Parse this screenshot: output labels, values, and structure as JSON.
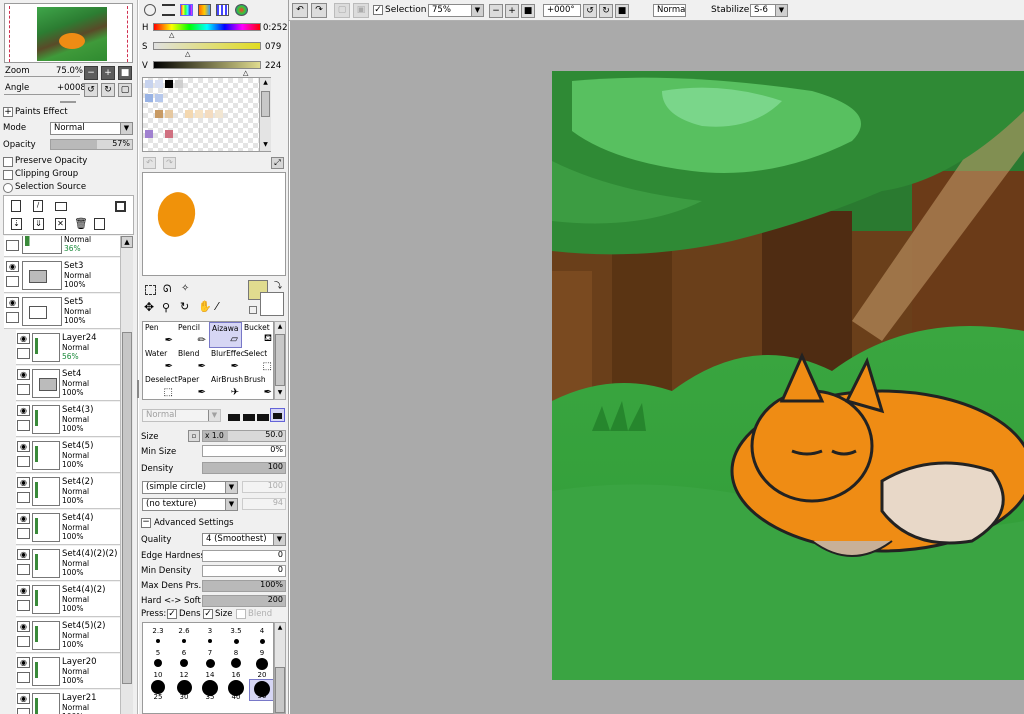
{
  "navigator": {
    "zoom_label": "Zoom",
    "zoom_value": "75.0%",
    "angle_label": "Angle",
    "angle_value": "+0008"
  },
  "paints_effect": {
    "title": "Paints Effect",
    "mode_label": "Mode",
    "mode_value": "Normal",
    "opacity_label": "Opacity",
    "opacity_value": "57%",
    "opacity_level": 0.57,
    "preserve_opacity": "Preserve Opacity",
    "clipping_group": "Clipping Group",
    "selection_source": "Selection Source"
  },
  "layers": [
    {
      "name": "",
      "mode": "Normal",
      "opacity": "36%",
      "kind": "partial",
      "indent": false
    },
    {
      "name": "Set3",
      "mode": "Normal",
      "opacity": "100%",
      "kind": "folder",
      "indent": false
    },
    {
      "name": "Set5",
      "mode": "Normal",
      "opacity": "100%",
      "kind": "folder-open",
      "indent": false
    },
    {
      "name": "Layer24",
      "mode": "Normal",
      "opacity": "56%",
      "kind": "layer",
      "indent": true
    },
    {
      "name": "Set4",
      "mode": "Normal",
      "opacity": "100%",
      "kind": "folder",
      "indent": true
    },
    {
      "name": "Set4(3)",
      "mode": "Normal",
      "opacity": "100%",
      "kind": "layer",
      "indent": true
    },
    {
      "name": "Set4(5)",
      "mode": "Normal",
      "opacity": "100%",
      "kind": "layer",
      "indent": true
    },
    {
      "name": "Set4(2)",
      "mode": "Normal",
      "opacity": "100%",
      "kind": "layer",
      "indent": true
    },
    {
      "name": "Set4(4)",
      "mode": "Normal",
      "opacity": "100%",
      "kind": "layer",
      "indent": true
    },
    {
      "name": "Set4(4)(2)(2)",
      "mode": "Normal",
      "opacity": "100%",
      "kind": "layer",
      "indent": true
    },
    {
      "name": "Set4(4)(2)",
      "mode": "Normal",
      "opacity": "100%",
      "kind": "layer",
      "indent": true
    },
    {
      "name": "Set4(5)(2)",
      "mode": "Normal",
      "opacity": "100%",
      "kind": "layer",
      "indent": true
    },
    {
      "name": "Layer20",
      "mode": "Normal",
      "opacity": "100%",
      "kind": "layer",
      "indent": true
    },
    {
      "name": "Layer21",
      "mode": "Normal",
      "opacity": "100%",
      "kind": "layer",
      "indent": true
    }
  ],
  "color": {
    "h_label": "H",
    "h_value": "0:252",
    "s_label": "S",
    "s_value": "079",
    "v_label": "V",
    "v_value": "224",
    "primary": "#e0dc8f",
    "brush_preview": "#f0920a"
  },
  "tools": [
    {
      "label": "Pen",
      "icon": "pen-icon",
      "glyph": "✒"
    },
    {
      "label": "Pencil",
      "icon": "pencil-icon",
      "glyph": "✏"
    },
    {
      "label": "Aizawa",
      "icon": "eraser-icon",
      "glyph": "▱",
      "selected": true
    },
    {
      "label": "Bucket",
      "icon": "bucket-icon",
      "glyph": "⛾"
    },
    {
      "label": "Water",
      "icon": "water-brush-icon",
      "glyph": "✒"
    },
    {
      "label": "Blend",
      "icon": "blend-brush-icon",
      "glyph": "✒"
    },
    {
      "label": "BlurEffec",
      "icon": "blur-brush-icon",
      "glyph": "✒"
    },
    {
      "label": "Select",
      "icon": "select-brush-icon",
      "glyph": "⬚"
    },
    {
      "label": "Deselect",
      "icon": "deselect-brush-icon",
      "glyph": "⬚"
    },
    {
      "label": "Paper",
      "icon": "paper-brush-icon",
      "glyph": "✒"
    },
    {
      "label": "AirBrush",
      "icon": "airbrush-icon",
      "glyph": "✈"
    },
    {
      "label": "Brush",
      "icon": "brush-icon",
      "glyph": "✒"
    }
  ],
  "brush": {
    "blend_mode": "Normal",
    "size_label": "Size",
    "size_multiplier": "x 1.0",
    "size_value": "50.0",
    "min_size_label": "Min Size",
    "min_size_value": "0%",
    "density_label": "Density",
    "density_value": "100",
    "shape": "(simple circle)",
    "shape_value": "100",
    "texture": "(no texture)",
    "texture_value": "94",
    "advanced_title": "Advanced Settings",
    "quality_label": "Quality",
    "quality_value": "4 (Smoothest)",
    "edge_hardness_label": "Edge Hardness",
    "edge_hardness_value": "0",
    "min_density_label": "Min Density",
    "min_density_value": "0",
    "max_dens_prs_label": "Max Dens Prs.",
    "max_dens_prs_value": "100%",
    "hard_soft_label": "Hard <-> Soft",
    "hard_soft_value": "200",
    "press_label": "Press:",
    "press_dens": "Dens",
    "press_size": "Size",
    "press_blend": "Blend"
  },
  "brush_sizes": [
    "2.3",
    "2.6",
    "3",
    "3.5",
    "4",
    "5",
    "6",
    "7",
    "8",
    "9",
    "10",
    "12",
    "14",
    "16",
    "20",
    "25",
    "30",
    "35",
    "40",
    "50"
  ],
  "toolbar": {
    "selection_label": "Selection",
    "zoom_value": "75%",
    "angle_value": "+000°",
    "blend_value": "Normal",
    "stabilizer_label": "Stabilizer",
    "stabilizer_value": "S-6"
  }
}
